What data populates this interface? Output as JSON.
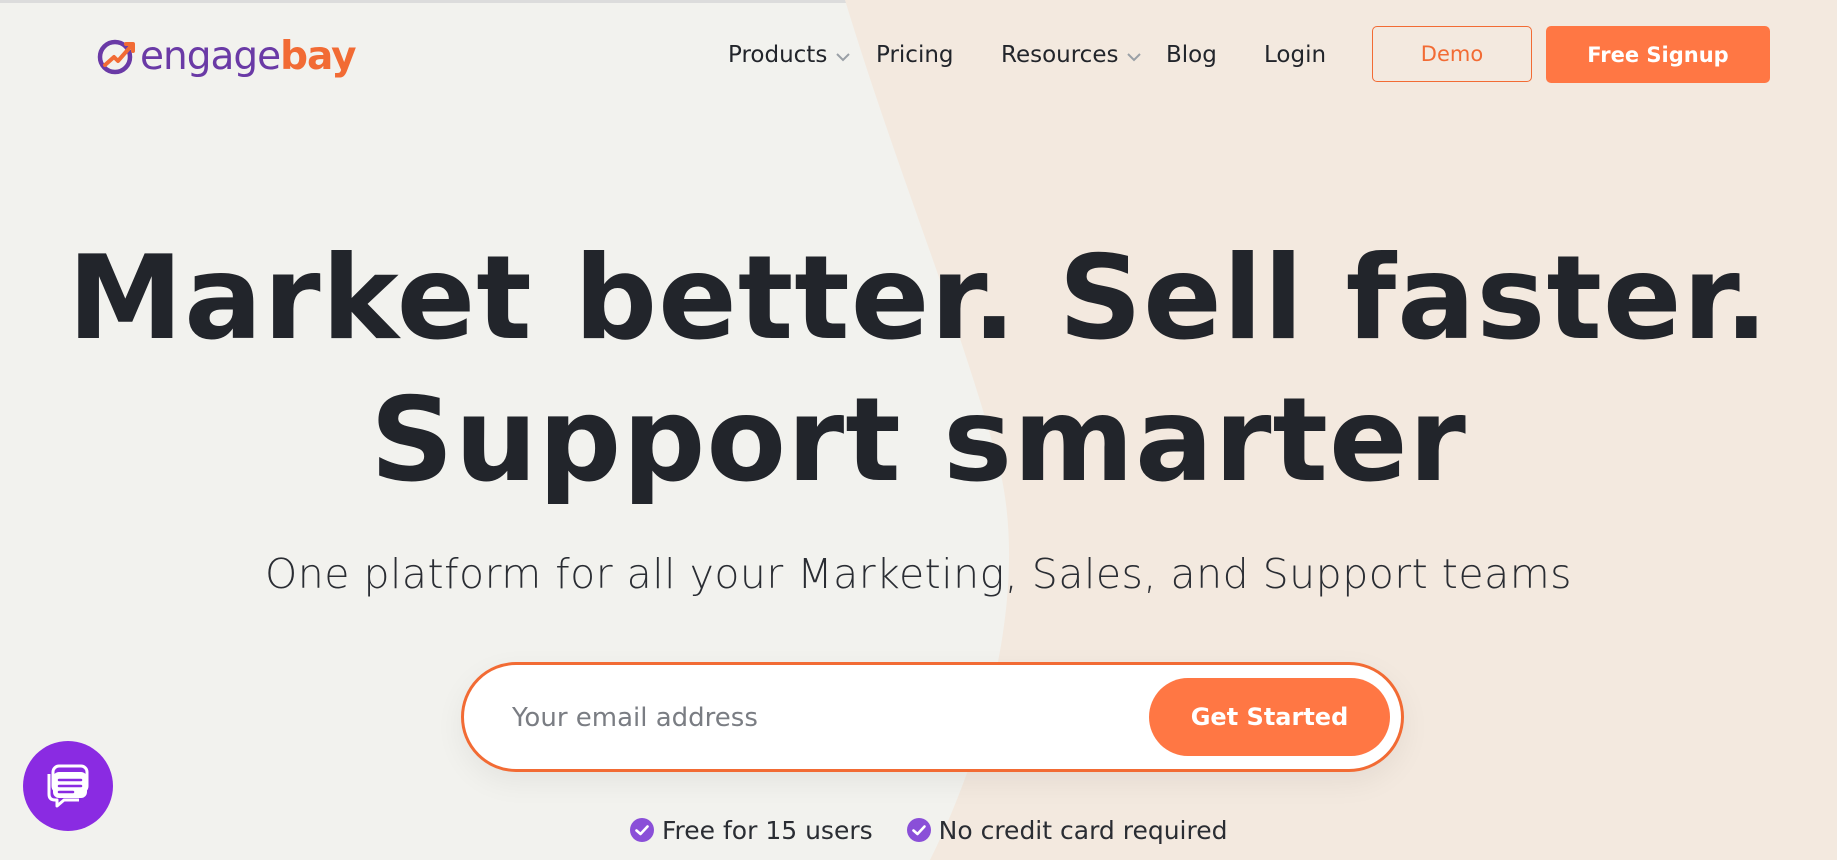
{
  "brand": {
    "name_part1": "engage",
    "name_part2": "bay"
  },
  "nav": {
    "products": "Products",
    "pricing": "Pricing",
    "resources": "Resources",
    "blog": "Blog",
    "login": "Login",
    "demo": "Demo",
    "free_signup": "Free Signup"
  },
  "hero": {
    "headline_line1": "Market better. Sell faster.",
    "headline_line2": "Support smarter",
    "subtitle": "One platform for all your Marketing, Sales, and Support teams",
    "email_placeholder": "Your email address",
    "cta": "Get Started",
    "perks": [
      "Free for 15 users",
      "No credit card required"
    ]
  },
  "colors": {
    "brand_purple": "#6a3aa6",
    "brand_orange": "#f26b34",
    "button_orange": "#ff7744",
    "chat_purple": "#8a2be2",
    "check_purple": "#8a4fd8"
  },
  "icons": {
    "products_dropdown": "chevron-down-icon",
    "resources_dropdown": "chevron-down-icon",
    "perk_check": "check-circle-icon",
    "chat": "chat-icon"
  }
}
